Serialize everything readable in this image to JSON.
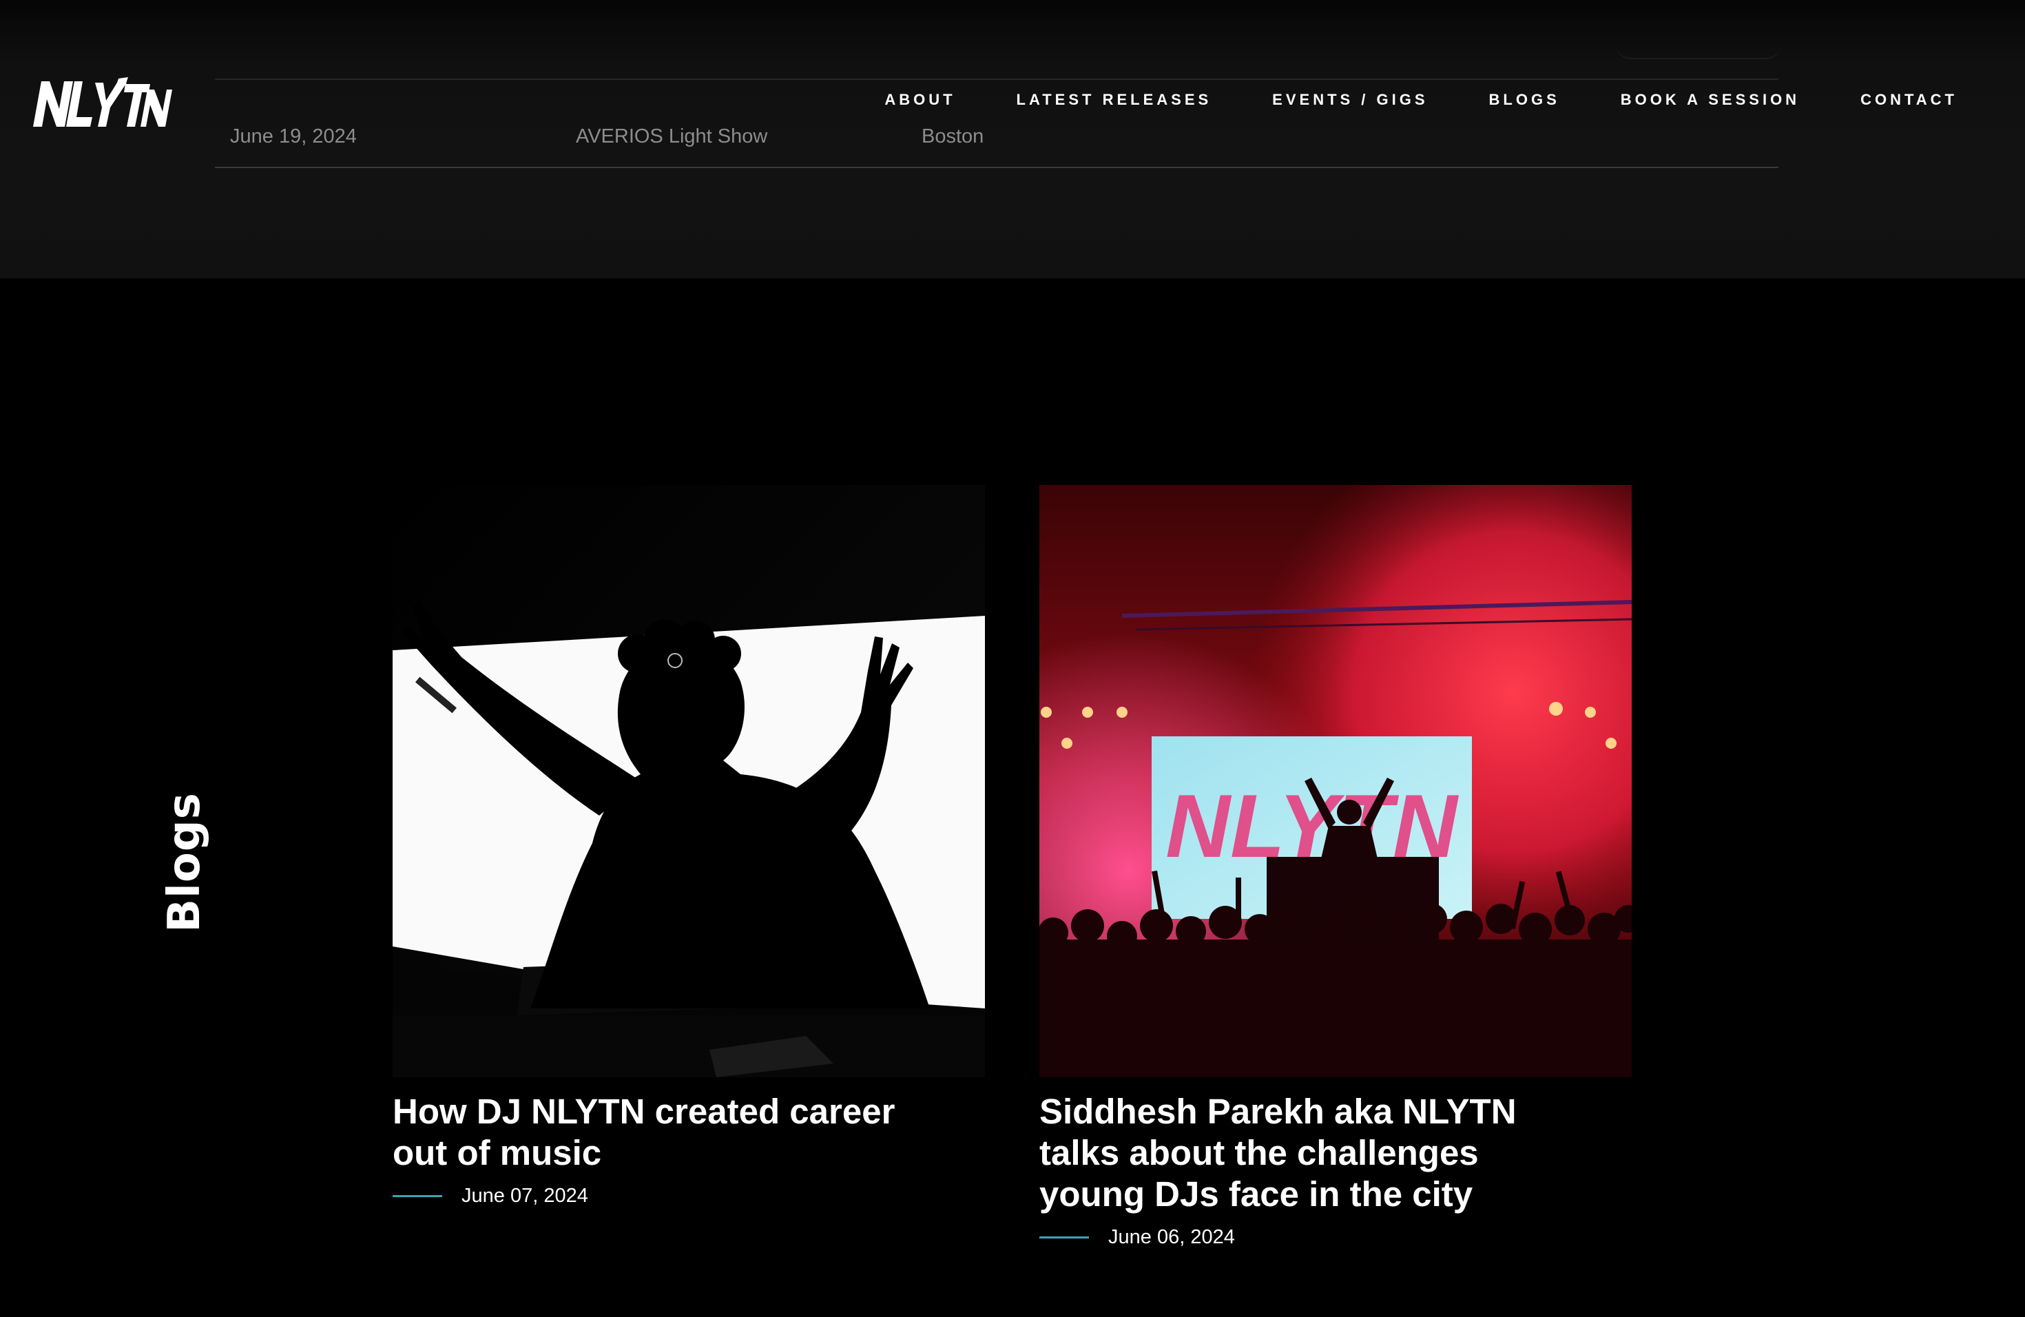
{
  "brand": {
    "logo_text": "NLYTN"
  },
  "nav": {
    "items": [
      {
        "label": "ABOUT"
      },
      {
        "label": "LATEST RELEASES"
      },
      {
        "label": "EVENTS / GIGS"
      },
      {
        "label": "BLOGS"
      },
      {
        "label": "BOOK A SESSION"
      },
      {
        "label": "CONTACT"
      }
    ]
  },
  "events": {
    "rows": [
      {
        "date": "June 19, 2024",
        "event": "AVERIOS Light Show",
        "venue": "Boston"
      }
    ]
  },
  "blogs": {
    "heading": "Blogs",
    "posts": [
      {
        "title": "How DJ NLYTN created career out of music",
        "date": "June 07, 2024",
        "image": "dj-silhouette-photo"
      },
      {
        "title": "Siddhesh Parekh aka NLYTN talks about the challenges young DJs face in the city",
        "date": "June 06, 2024",
        "image": "concert-crowd-photo",
        "screen_text": "NLYTN"
      }
    ]
  },
  "colors": {
    "background": "#000000",
    "accent": "#3aa4b2",
    "muted_text": "#8d8d8d"
  }
}
